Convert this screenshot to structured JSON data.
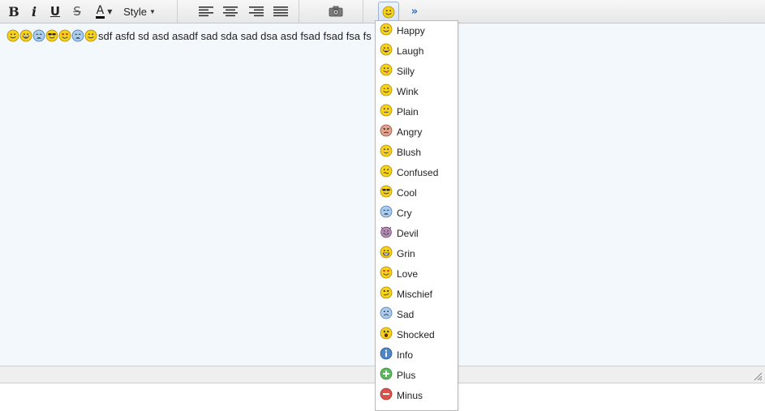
{
  "toolbar": {
    "bold_label": "B",
    "italic_label": "i",
    "underline_label": "U",
    "strike_label": "S",
    "font_color_label": "A",
    "style_label": "Style",
    "more_label": "»"
  },
  "editor": {
    "text": "sdf asfd sd asd asadf sad sda sad dsa asd fsad fsad fsa fs",
    "emoticons": [
      "happy-icon",
      "laugh-icon",
      "cry-icon",
      "cool-icon",
      "love-icon",
      "cry-icon",
      "happy-icon"
    ]
  },
  "emoticon_menu": {
    "items": [
      {
        "label": "Happy",
        "icon": "happy-icon"
      },
      {
        "label": "Laugh",
        "icon": "laugh-icon"
      },
      {
        "label": "Silly",
        "icon": "silly-icon"
      },
      {
        "label": "Wink",
        "icon": "wink-icon"
      },
      {
        "label": "Plain",
        "icon": "plain-icon"
      },
      {
        "label": "Angry",
        "icon": "angry-icon"
      },
      {
        "label": "Blush",
        "icon": "blush-icon"
      },
      {
        "label": "Confused",
        "icon": "confused-icon"
      },
      {
        "label": "Cool",
        "icon": "cool-icon"
      },
      {
        "label": "Cry",
        "icon": "cry-icon"
      },
      {
        "label": "Devil",
        "icon": "devil-icon"
      },
      {
        "label": "Grin",
        "icon": "grin-icon"
      },
      {
        "label": "Love",
        "icon": "love-icon"
      },
      {
        "label": "Mischief",
        "icon": "mischief-icon"
      },
      {
        "label": "Sad",
        "icon": "sad-icon"
      },
      {
        "label": "Shocked",
        "icon": "shocked-icon"
      },
      {
        "label": "Info",
        "icon": "info-icon"
      },
      {
        "label": "Plus",
        "icon": "plus-icon"
      },
      {
        "label": "Minus",
        "icon": "minus-icon"
      }
    ]
  },
  "colors": {
    "editor_bg": "#f3f8fc",
    "smiley_yellow": "#f7d21b",
    "cry_blue": "#a9cdf0",
    "angry_pink": "#e4a18c",
    "devil_purple": "#b98bb8",
    "info_blue": "#4f86c6",
    "plus_green": "#5cb85c",
    "minus_red": "#d9534f",
    "accent_blue": "#2f6fc6"
  }
}
